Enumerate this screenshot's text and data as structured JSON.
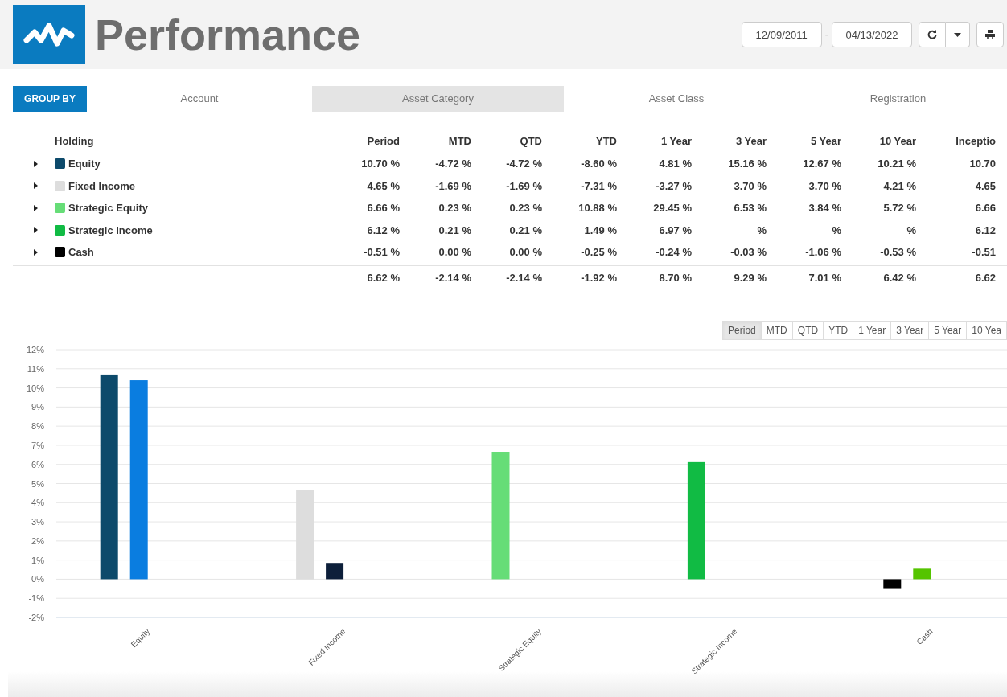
{
  "header": {
    "title": "Performance",
    "start_date": "12/09/2011",
    "date_separator": "-",
    "end_date": "04/13/2022"
  },
  "group_by": {
    "label": "GROUP BY",
    "tabs": [
      {
        "label": "Account",
        "selected": false
      },
      {
        "label": "Asset Category",
        "selected": true
      },
      {
        "label": "Asset Class",
        "selected": false
      },
      {
        "label": "Registration",
        "selected": false
      }
    ]
  },
  "table": {
    "columns": [
      "Holding",
      "Period",
      "MTD",
      "QTD",
      "YTD",
      "1 Year",
      "3 Year",
      "5 Year",
      "10 Year",
      "Inceptio"
    ],
    "rows": [
      {
        "name": "Equity",
        "color": "#0d4a6b",
        "expanded": false,
        "values": [
          "10.70 %",
          "-4.72 %",
          "-4.72 %",
          "-8.60 %",
          "4.81 %",
          "15.16 %",
          "12.67 %",
          "10.21 %",
          "10.70"
        ]
      },
      {
        "name": "Fixed Income",
        "color": "#dddddd",
        "expanded": false,
        "values": [
          "4.65 %",
          "-1.69 %",
          "-1.69 %",
          "-7.31 %",
          "-3.27 %",
          "3.70 %",
          "3.70 %",
          "4.21 %",
          "4.65"
        ]
      },
      {
        "name": "Strategic Equity",
        "color": "#66dd77",
        "expanded": false,
        "values": [
          "6.66 %",
          "0.23 %",
          "0.23 %",
          "10.88 %",
          "29.45 %",
          "6.53 %",
          "3.84 %",
          "5.72 %",
          "6.66"
        ]
      },
      {
        "name": "Strategic Income",
        "color": "#11bb44",
        "expanded": false,
        "values": [
          "6.12 %",
          "0.21 %",
          "0.21 %",
          "1.49 %",
          "6.97 %",
          "%",
          "%",
          "%",
          "6.12"
        ]
      },
      {
        "name": "Cash",
        "color": "#000000",
        "expanded": false,
        "values": [
          "-0.51 %",
          "0.00 %",
          "0.00 %",
          "-0.25 %",
          "-0.24 %",
          "-0.03 %",
          "-1.06 %",
          "-0.53 %",
          "-0.51"
        ]
      }
    ],
    "totals": [
      "6.62 %",
      "-2.14 %",
      "-2.14 %",
      "-1.92 %",
      "8.70 %",
      "9.29 %",
      "7.01 %",
      "6.42 %",
      "6.62"
    ]
  },
  "period_buttons": [
    {
      "label": "Period",
      "selected": true
    },
    {
      "label": "MTD",
      "selected": false
    },
    {
      "label": "QTD",
      "selected": false
    },
    {
      "label": "YTD",
      "selected": false
    },
    {
      "label": "1 Year",
      "selected": false
    },
    {
      "label": "3 Year",
      "selected": false
    },
    {
      "label": "5 Year",
      "selected": false
    },
    {
      "label": "10 Yea",
      "selected": false
    }
  ],
  "chart_data": {
    "type": "bar",
    "categories": [
      "Equity",
      "Fixed Income",
      "Strategic Equity",
      "Strategic Income",
      "Cash"
    ],
    "grid": true,
    "ylim": [
      -2,
      12
    ],
    "yticks": [
      {
        "value": 12,
        "label": "12%"
      },
      {
        "value": 11,
        "label": "11%"
      },
      {
        "value": 10,
        "label": "10%"
      },
      {
        "value": 9,
        "label": "9%"
      },
      {
        "value": 8,
        "label": "8%"
      },
      {
        "value": 7,
        "label": "7%"
      },
      {
        "value": 6,
        "label": "6%"
      },
      {
        "value": 5,
        "label": "5%"
      },
      {
        "value": 4,
        "label": "4%"
      },
      {
        "value": 3,
        "label": "3%"
      },
      {
        "value": 2,
        "label": "2%"
      },
      {
        "value": 1,
        "label": "1%"
      },
      {
        "value": 0,
        "label": "0%"
      },
      {
        "value": -1,
        "label": "-1%"
      },
      {
        "value": -2,
        "label": "-2%"
      }
    ],
    "series": [
      {
        "colors": [
          "#0d4a6b",
          "#dddddd",
          "#66dd77",
          "#11bb44",
          "#000000"
        ],
        "values": [
          10.7,
          4.65,
          6.66,
          6.12,
          -0.51
        ]
      },
      {
        "colors": [
          "#0a7de0",
          "#0d1f3a",
          null,
          null,
          "#55c400"
        ],
        "values": [
          10.4,
          0.85,
          null,
          null,
          0.55
        ]
      }
    ]
  }
}
